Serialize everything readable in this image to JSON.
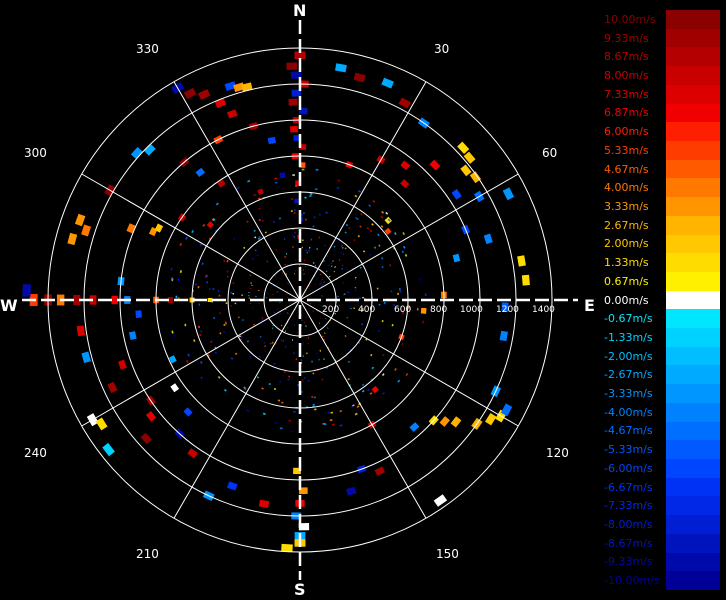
{
  "chart_data": {
    "type": "polar-radar",
    "directions": {
      "north": "N",
      "south": "S",
      "east": "E",
      "west": "W"
    },
    "azimuth_labels": [
      "30",
      "60",
      "120",
      "150",
      "210",
      "240",
      "300",
      "330"
    ],
    "range_labels": [
      "200",
      "400",
      "600",
      "800",
      "1000",
      "1200",
      "1400"
    ],
    "max_range": 1400,
    "rings_count": 7,
    "spoke_interval_deg": 30,
    "legend": {
      "levels": [
        {
          "value": "10.00m/s",
          "color": "#8B0000"
        },
        {
          "value": "9.33m/s",
          "color": "#A00000"
        },
        {
          "value": "8.67m/s",
          "color": "#B40000"
        },
        {
          "value": "8.00m/s",
          "color": "#C80000"
        },
        {
          "value": "7.33m/s",
          "color": "#DC0000"
        },
        {
          "value": "6.87m/s",
          "color": "#F00000"
        },
        {
          "value": "6.00m/s",
          "color": "#FF1E00"
        },
        {
          "value": "5.33m/s",
          "color": "#FF3C00"
        },
        {
          "value": "4.67m/s",
          "color": "#FF5A00"
        },
        {
          "value": "4.00m/s",
          "color": "#FF7800"
        },
        {
          "value": "3.33m/s",
          "color": "#FF9600"
        },
        {
          "value": "2.67m/s",
          "color": "#FFB400"
        },
        {
          "value": "2.00m/s",
          "color": "#FFC800"
        },
        {
          "value": "1.33m/s",
          "color": "#FFDC00"
        },
        {
          "value": "0.67m/s",
          "color": "#FFF000"
        },
        {
          "value": "0.00m/s",
          "color": "#FFFFFF"
        },
        {
          "value": "-0.67m/s",
          "color": "#00E6FF"
        },
        {
          "value": "-1.33m/s",
          "color": "#00D2FF"
        },
        {
          "value": "-2.00m/s",
          "color": "#00BEFF"
        },
        {
          "value": "-2.67m/s",
          "color": "#00AAFF"
        },
        {
          "value": "-3.33m/s",
          "color": "#0096FF"
        },
        {
          "value": "-4.00m/s",
          "color": "#0082FF"
        },
        {
          "value": "-4.67m/s",
          "color": "#006EFF"
        },
        {
          "value": "-5.33m/s",
          "color": "#005AFF"
        },
        {
          "value": "-6.00m/s",
          "color": "#0046FF"
        },
        {
          "value": "-6.67m/s",
          "color": "#0032F5"
        },
        {
          "value": "-7.33m/s",
          "color": "#0028E6"
        },
        {
          "value": "-8.00m/s",
          "color": "#001ED2"
        },
        {
          "value": "-8.67m/s",
          "color": "#0014BE"
        },
        {
          "value": "-9.33m/s",
          "color": "#000AAA"
        },
        {
          "value": "-10.00m/s",
          "color": "#000096"
        }
      ]
    },
    "echoes": [
      {
        "az": 0,
        "r": 1360,
        "v": 8.67
      },
      {
        "az": 358,
        "r": 1300,
        "v": 10
      },
      {
        "az": 359,
        "r": 1250,
        "v": -9.33
      },
      {
        "az": 1,
        "r": 1200,
        "v": 8
      },
      {
        "az": 359,
        "r": 1150,
        "v": -8
      },
      {
        "az": 358,
        "r": 1100,
        "v": 9.33
      },
      {
        "az": 1,
        "r": 1050,
        "v": -8.67
      },
      {
        "az": 359,
        "r": 1000,
        "v": 8.67
      },
      {
        "az": 358,
        "r": 950,
        "v": 7.33
      },
      {
        "az": 359,
        "r": 900,
        "v": -8
      },
      {
        "az": 1,
        "r": 850,
        "v": 8
      },
      {
        "az": 358,
        "r": 800,
        "v": 6.87
      },
      {
        "az": 1,
        "r": 750,
        "v": 4.67
      },
      {
        "az": 359,
        "r": 650,
        "v": 7.33
      },
      {
        "az": 358,
        "r": 550,
        "v": -8.67
      },
      {
        "az": 1,
        "r": 450,
        "v": -9.33
      },
      {
        "az": 359,
        "r": 350,
        "v": 8
      },
      {
        "az": 10,
        "r": 1310,
        "v": -2.67
      },
      {
        "az": 15,
        "r": 1280,
        "v": 10
      },
      {
        "az": 22,
        "r": 1300,
        "v": -2.67
      },
      {
        "az": 28,
        "r": 1240,
        "v": 9.33
      },
      {
        "az": 35,
        "r": 1200,
        "v": -4
      },
      {
        "az": 45,
        "r": 1060,
        "v": 6.87
      },
      {
        "az": 50,
        "r": 1230,
        "v": 2
      },
      {
        "az": 52,
        "r": 1170,
        "v": 2
      },
      {
        "az": 47,
        "r": 1240,
        "v": 1.33
      },
      {
        "az": 55,
        "r": 1190,
        "v": 2.67
      },
      {
        "az": 56,
        "r": 1050,
        "v": -6
      },
      {
        "az": 60,
        "r": 1150,
        "v": -4.67
      },
      {
        "az": 63,
        "r": 1300,
        "v": -3.33
      },
      {
        "az": 72,
        "r": 1100,
        "v": -4
      },
      {
        "az": 67,
        "r": 1000,
        "v": -6
      },
      {
        "az": 38,
        "r": 950,
        "v": 7.33
      },
      {
        "az": 42,
        "r": 870,
        "v": 8
      },
      {
        "az": 30,
        "r": 900,
        "v": 8
      },
      {
        "az": 48,
        "r": 660,
        "v": 1.33
      },
      {
        "az": 52,
        "r": 620,
        "v": 5.33
      },
      {
        "az": 20,
        "r": 800,
        "v": 6.87
      },
      {
        "az": 75,
        "r": 900,
        "v": -3.33
      },
      {
        "az": 80,
        "r": 1250,
        "v": 1.33
      },
      {
        "az": 85,
        "r": 1260,
        "v": 1.33
      },
      {
        "az": 92,
        "r": 1140,
        "v": -5.33
      },
      {
        "az": 88,
        "r": 800,
        "v": 4
      },
      {
        "az": 95,
        "r": 690,
        "v": 3.33
      },
      {
        "az": 100,
        "r": 1150,
        "v": -4
      },
      {
        "az": 120,
        "r": 1290,
        "v": 1.33
      },
      {
        "az": 122,
        "r": 1250,
        "v": 2
      },
      {
        "az": 125,
        "r": 1200,
        "v": 2.67
      },
      {
        "az": 115,
        "r": 1200,
        "v": -3.33
      },
      {
        "az": 118,
        "r": 1300,
        "v": -4.67
      },
      {
        "az": 128,
        "r": 1100,
        "v": 2.67
      },
      {
        "az": 132,
        "r": 1000,
        "v": 1.33
      },
      {
        "az": 130,
        "r": 1050,
        "v": 3.33
      },
      {
        "az": 138,
        "r": 950,
        "v": -4
      },
      {
        "az": 145,
        "r": 1360,
        "v": 0
      },
      {
        "az": 155,
        "r": 1050,
        "v": 9.33
      },
      {
        "az": 160,
        "r": 1000,
        "v": -8
      },
      {
        "az": 165,
        "r": 1100,
        "v": -9.33
      },
      {
        "az": 150,
        "r": 800,
        "v": 8
      },
      {
        "az": 110,
        "r": 600,
        "v": 5.33
      },
      {
        "az": 140,
        "r": 650,
        "v": 6.87
      },
      {
        "az": 180,
        "r": 1310,
        "v": -2.67
      },
      {
        "az": 179,
        "r": 1260,
        "v": 0
      },
      {
        "az": 181,
        "r": 1200,
        "v": -4
      },
      {
        "az": 180,
        "r": 1130,
        "v": 6.87
      },
      {
        "az": 179,
        "r": 1060,
        "v": 3.33
      },
      {
        "az": 181,
        "r": 950,
        "v": 2
      },
      {
        "az": 180,
        "r": 1350,
        "v": 2
      },
      {
        "az": 183,
        "r": 1380,
        "v": 1.33
      },
      {
        "az": 190,
        "r": 1150,
        "v": 7.33
      },
      {
        "az": 200,
        "r": 1100,
        "v": -6.87
      },
      {
        "az": 205,
        "r": 1200,
        "v": -3.33
      },
      {
        "az": 215,
        "r": 1040,
        "v": 8
      },
      {
        "az": 222,
        "r": 1000,
        "v": -9.33
      },
      {
        "az": 228,
        "r": 1150,
        "v": 10
      },
      {
        "az": 232,
        "r": 1050,
        "v": 7.33
      },
      {
        "az": 236,
        "r": 1000,
        "v": 9.33
      },
      {
        "az": 225,
        "r": 880,
        "v": -6
      },
      {
        "az": 235,
        "r": 850,
        "v": 0
      },
      {
        "az": 240,
        "r": 1330,
        "v": 0
      },
      {
        "az": 238,
        "r": 1300,
        "v": 1.33
      },
      {
        "az": 232,
        "r": 1350,
        "v": -1.33
      },
      {
        "az": 245,
        "r": 1150,
        "v": 9.33
      },
      {
        "az": 250,
        "r": 1050,
        "v": 8
      },
      {
        "az": 255,
        "r": 1230,
        "v": -3.33
      },
      {
        "az": 258,
        "r": 950,
        "v": -4
      },
      {
        "az": 262,
        "r": 1230,
        "v": 7.33
      },
      {
        "az": 265,
        "r": 900,
        "v": -6
      },
      {
        "az": 245,
        "r": 780,
        "v": -2.67
      },
      {
        "az": 270,
        "r": 1480,
        "v": 5.33
      },
      {
        "az": 270,
        "r": 1400,
        "v": 10
      },
      {
        "az": 270,
        "r": 1330,
        "v": 4
      },
      {
        "az": 270,
        "r": 1240,
        "v": 9.33
      },
      {
        "az": 270,
        "r": 1150,
        "v": 8
      },
      {
        "az": 270,
        "r": 1030,
        "v": 6.87
      },
      {
        "az": 270,
        "r": 960,
        "v": -4
      },
      {
        "az": 270,
        "r": 800,
        "v": 4.67
      },
      {
        "az": 270,
        "r": 720,
        "v": 9.33
      },
      {
        "az": 270,
        "r": 600,
        "v": 2
      },
      {
        "az": 270,
        "r": 500,
        "v": 1.33
      },
      {
        "az": 272,
        "r": 1520,
        "v": -9.33
      },
      {
        "az": 276,
        "r": 1000,
        "v": -3.33
      },
      {
        "az": 285,
        "r": 1310,
        "v": 3.33
      },
      {
        "az": 288,
        "r": 1250,
        "v": 4
      },
      {
        "az": 290,
        "r": 1300,
        "v": 3.33
      },
      {
        "az": 293,
        "r": 1020,
        "v": 4
      },
      {
        "az": 295,
        "r": 900,
        "v": 3.33
      },
      {
        "az": 297,
        "r": 880,
        "v": 2
      },
      {
        "az": 300,
        "r": 1220,
        "v": 10
      },
      {
        "az": 305,
        "r": 800,
        "v": 8
      },
      {
        "az": 310,
        "r": 650,
        "v": 7.33
      },
      {
        "az": 312,
        "r": 1220,
        "v": -3.33
      },
      {
        "az": 315,
        "r": 1180,
        "v": -2.67
      },
      {
        "az": 320,
        "r": 1000,
        "v": 10
      },
      {
        "az": 322,
        "r": 900,
        "v": -4.67
      },
      {
        "az": 326,
        "r": 780,
        "v": 8.67
      },
      {
        "az": 330,
        "r": 1360,
        "v": -9.33
      },
      {
        "az": 332,
        "r": 1300,
        "v": 10
      },
      {
        "az": 335,
        "r": 1260,
        "v": 9.33
      },
      {
        "az": 338,
        "r": 1180,
        "v": 7.33
      },
      {
        "az": 340,
        "r": 1100,
        "v": 8
      },
      {
        "az": 342,
        "r": 1250,
        "v": -6
      },
      {
        "az": 344,
        "r": 1230,
        "v": 3.33
      },
      {
        "az": 346,
        "r": 1220,
        "v": 2.67
      },
      {
        "az": 333,
        "r": 1000,
        "v": 5.33
      },
      {
        "az": 345,
        "r": 1000,
        "v": 9.33
      },
      {
        "az": 350,
        "r": 900,
        "v": -6
      },
      {
        "az": 352,
        "r": 700,
        "v": -9.33
      },
      {
        "az": 340,
        "r": 640,
        "v": 8.67
      }
    ]
  }
}
